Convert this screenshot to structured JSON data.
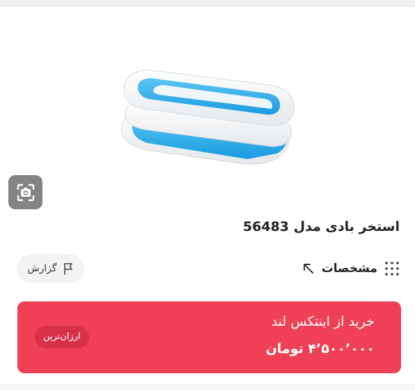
{
  "product": {
    "title": "استخر بادی مدل 56483",
    "image_icon": "inflatable-pool-image"
  },
  "toolbar": {
    "visual_search_icon": "camera-search-icon"
  },
  "specs": {
    "label": "مشخصات",
    "grid_icon": "dots-grid-icon",
    "arrow_icon": "arrow-up-left-icon"
  },
  "report": {
    "label": "گزارش",
    "flag_icon": "flag-icon"
  },
  "offer": {
    "seller": "خرید از اینتکس لند",
    "price": "۴٬۵۰۰٬۰۰۰ تومان",
    "badge": "ارزان‌ترین",
    "colors": {
      "card": "#ef4056",
      "badge": "#d83147"
    }
  }
}
